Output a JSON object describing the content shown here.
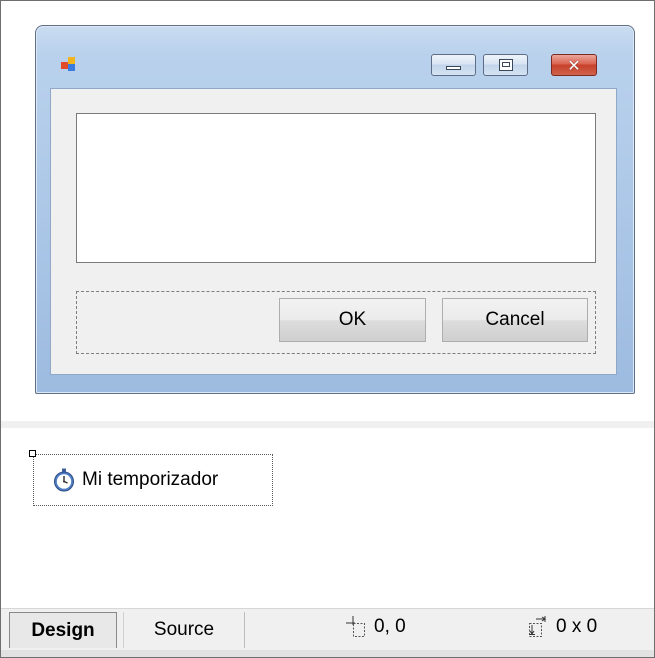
{
  "form": {
    "ok_label": "OK",
    "cancel_label": "Cancel",
    "textbox_value": ""
  },
  "tray": {
    "component_label": "Mi temporizador",
    "component_icon": "stopwatch-icon"
  },
  "statusbar": {
    "design_tab": "Design",
    "source_tab": "Source",
    "location": "0, 0",
    "size": "0 x 0"
  },
  "colors": {
    "titlebar": "#b9d1ec",
    "close_button": "#c7402b",
    "client_background": "#f0f0f0"
  }
}
